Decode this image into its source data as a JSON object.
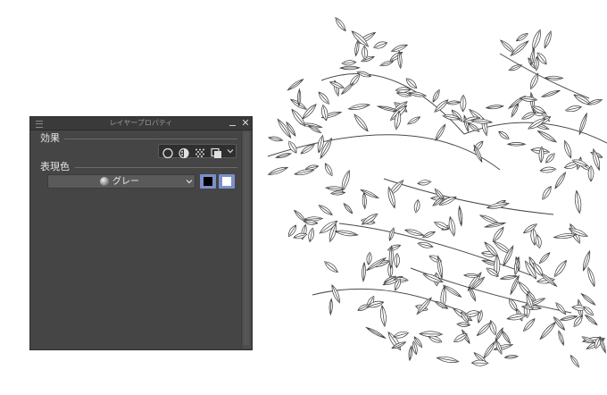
{
  "panel": {
    "title": "レイヤープロパティ",
    "close_glyph": "✕",
    "sections": {
      "effect": {
        "label": "効果",
        "icons": [
          "border-effect-icon",
          "tone-icon",
          "tone-pattern-icon",
          "layer-color-icon",
          "chevron-down-icon"
        ]
      },
      "expression_color": {
        "label": "表現色",
        "selected_value": "グレー",
        "icon": "gray-ball-icon",
        "swatches": [
          "#000000",
          "#ffffff"
        ]
      }
    }
  },
  "colors": {
    "panel_bg": "#454545",
    "titlebar_bg": "#3a3a3a",
    "swatch_highlight": "#7d8fc8",
    "canvas_bg": "#ffffff"
  }
}
